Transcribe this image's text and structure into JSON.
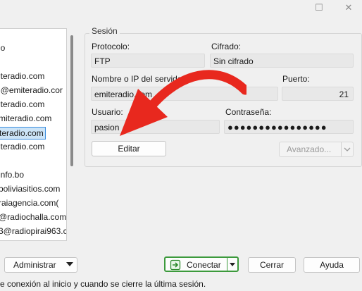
{
  "window": {
    "minimize_glyph": "—",
    "maximize_glyph": "☐",
    "close_glyph": "✕"
  },
  "sitelist": {
    "items": [
      "jo",
      "iteradio.com",
      "l@emiteradio.cor",
      "iteradio.com",
      "miteradio.com",
      "teradio.com",
      "iteradio.com",
      "info.bo",
      "boliviasitios.com",
      "raiagencia.com(",
      "@radiochalla.com",
      "3@radiopirai963.c"
    ],
    "selected_index": 5
  },
  "session": {
    "legend": "Sesión",
    "protocol_label": "Protocolo:",
    "protocol_value": "FTP",
    "cipher_label": "Cifrado:",
    "cipher_value": "Sin cifrado",
    "host_label": "Nombre o IP del servidor:",
    "host_value": "emiteradio.com",
    "port_label": "Puerto:",
    "port_value": "21",
    "user_label": "Usuario:",
    "user_value": "pasion",
    "password_label": "Contraseña:",
    "password_value": "●●●●●●●●●●●●●●●●",
    "edit_button": "Editar",
    "advanced_button": "Avanzado..."
  },
  "buttons": {
    "admin": "Administrar",
    "connect": "Conectar",
    "close": "Cerrar",
    "help": "Ayuda"
  },
  "footer": {
    "text": "e conexión al inicio y cuando se cierre la última sesión."
  },
  "colors": {
    "annotation_arrow": "#e8281e",
    "connect_border": "#3c9a3c",
    "selection": "#cce4f7"
  },
  "icons": {
    "connect": "connect-icon",
    "dropdown": "chevron-down-icon"
  }
}
